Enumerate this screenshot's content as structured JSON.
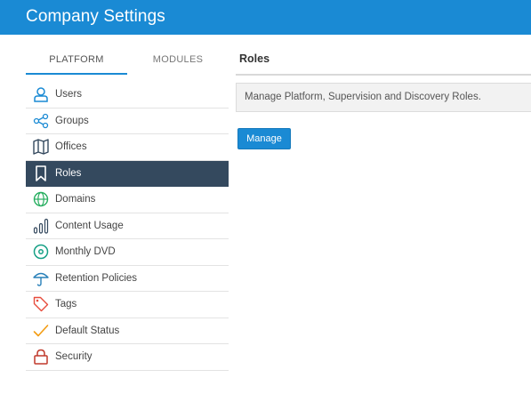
{
  "header": {
    "title": "Company Settings"
  },
  "tabs": [
    {
      "label": "PLATFORM",
      "active": true
    },
    {
      "label": "MODULES",
      "active": false
    }
  ],
  "sidebar": {
    "items": [
      {
        "label": "Users",
        "icon": "user-icon"
      },
      {
        "label": "Groups",
        "icon": "share-icon"
      },
      {
        "label": "Offices",
        "icon": "map-icon"
      },
      {
        "label": "Roles",
        "icon": "bookmark-icon",
        "active": true
      },
      {
        "label": "Domains",
        "icon": "globe-icon"
      },
      {
        "label": "Content Usage",
        "icon": "bar-chart-icon"
      },
      {
        "label": "Monthly DVD",
        "icon": "disc-icon"
      },
      {
        "label": "Retention Policies",
        "icon": "umbrella-icon"
      },
      {
        "label": "Tags",
        "icon": "tag-icon"
      },
      {
        "label": "Default Status",
        "icon": "checkmark-icon"
      },
      {
        "label": "Security",
        "icon": "lock-icon"
      }
    ]
  },
  "main": {
    "title": "Roles",
    "description": "Manage Platform, Supervision and Discovery Roles.",
    "manage_label": "Manage"
  },
  "colors": {
    "header_bg": "#1a8ad4",
    "active_item_bg": "#34495e",
    "accent": "#1a8ad4"
  }
}
